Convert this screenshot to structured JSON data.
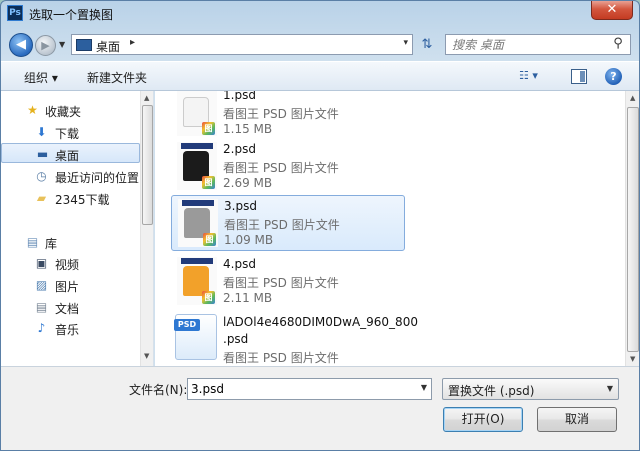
{
  "window": {
    "title": "选取一个置换图",
    "app_icon": "Ps",
    "close": "✕"
  },
  "address": {
    "location": "桌面",
    "chevron": "▸",
    "dropdown": "▾"
  },
  "search": {
    "placeholder": "搜索 桌面"
  },
  "toolbar": {
    "organize": "组织 ▾",
    "new_folder": "新建文件夹",
    "view": "☷ ▾",
    "help": "?"
  },
  "nav": {
    "items": [
      {
        "label": "收藏夹",
        "icon": "favorites-star-icon",
        "glyph": "★"
      },
      {
        "label": "下载",
        "icon": "downloads-folder-icon",
        "glyph": "⬇"
      },
      {
        "label": "桌面",
        "icon": "desktop-icon",
        "glyph": "▬"
      },
      {
        "label": "最近访问的位置",
        "icon": "recent-places-icon",
        "glyph": "◷"
      },
      {
        "label": "2345下载",
        "icon": "folder-icon",
        "glyph": "▰"
      },
      {
        "label": "库",
        "icon": "libraries-icon",
        "glyph": "▤"
      },
      {
        "label": "视频",
        "icon": "video-icon",
        "glyph": "▣"
      },
      {
        "label": "图片",
        "icon": "pictures-icon",
        "glyph": "▨"
      },
      {
        "label": "文档",
        "icon": "documents-icon",
        "glyph": "▤"
      },
      {
        "label": "音乐",
        "icon": "music-icon",
        "glyph": "♪"
      }
    ]
  },
  "files": [
    {
      "name": "1.psd",
      "type": "看图王 PSD 图片文件",
      "size": "1.15 MB",
      "color": "#f4f4f4"
    },
    {
      "name": "2.psd",
      "type": "看图王 PSD 图片文件",
      "size": "2.69 MB",
      "color": "#1b1b1b"
    },
    {
      "name": "3.psd",
      "type": "看图王 PSD 图片文件",
      "size": "1.09 MB",
      "color": "#9a9a9a"
    },
    {
      "name": "4.psd",
      "type": "看图王 PSD 图片文件",
      "size": "2.11 MB",
      "color": "#f2a12a"
    },
    {
      "name": "lADOl4e4680DIM0DwA_960_800",
      "name2": ".psd",
      "type": "看图王 PSD 图片文件",
      "icon_tag": "PSD"
    }
  ],
  "bottom": {
    "filename_label": "文件名(N):",
    "filename_value": "3.psd",
    "filetype": "置换文件 (.psd)",
    "open": "打开(O)",
    "cancel": "取消"
  },
  "colors": {
    "selection": "#d9eafc",
    "accent": "#2e78d2"
  }
}
